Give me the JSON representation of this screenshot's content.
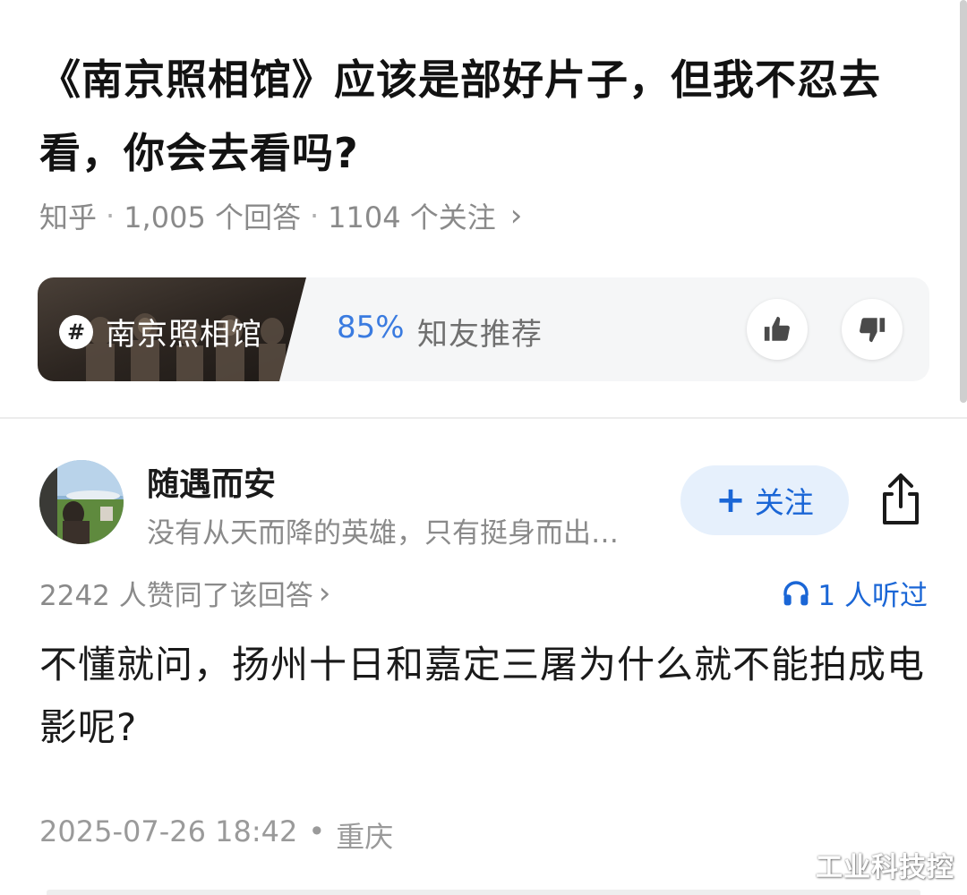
{
  "question": {
    "title": "《南京照相馆》应该是部好片子，但我不忍去看，你会去看吗?",
    "source": "知乎",
    "answers": "1,005 个回答",
    "followers": "1104 个关注"
  },
  "topic": {
    "name": "南京照相馆",
    "recommend_percent": "85%",
    "recommend_label": "知友推荐"
  },
  "answer": {
    "author_name": "随遇而安",
    "author_bio": "没有从天而降的英雄，只有挺身而出…",
    "follow_label": "关注",
    "upvotes": "2242 人赞同了该回答",
    "listened": "1 人听过",
    "content": "不懂就问，扬州十日和嘉定三屠为什么就不能拍成电影呢?",
    "date": "2025-07-26 18:42",
    "location": "重庆"
  },
  "watermark": "工业科技控",
  "colors": {
    "accent_blue": "#1a66d6",
    "follow_bg": "#e6f0fc",
    "meta_gray": "#8a8a8a"
  },
  "icons": [
    "hash-icon",
    "thumbs-up-icon",
    "thumbs-down-icon",
    "share-icon",
    "headphones-icon",
    "chevron-right-icon"
  ]
}
